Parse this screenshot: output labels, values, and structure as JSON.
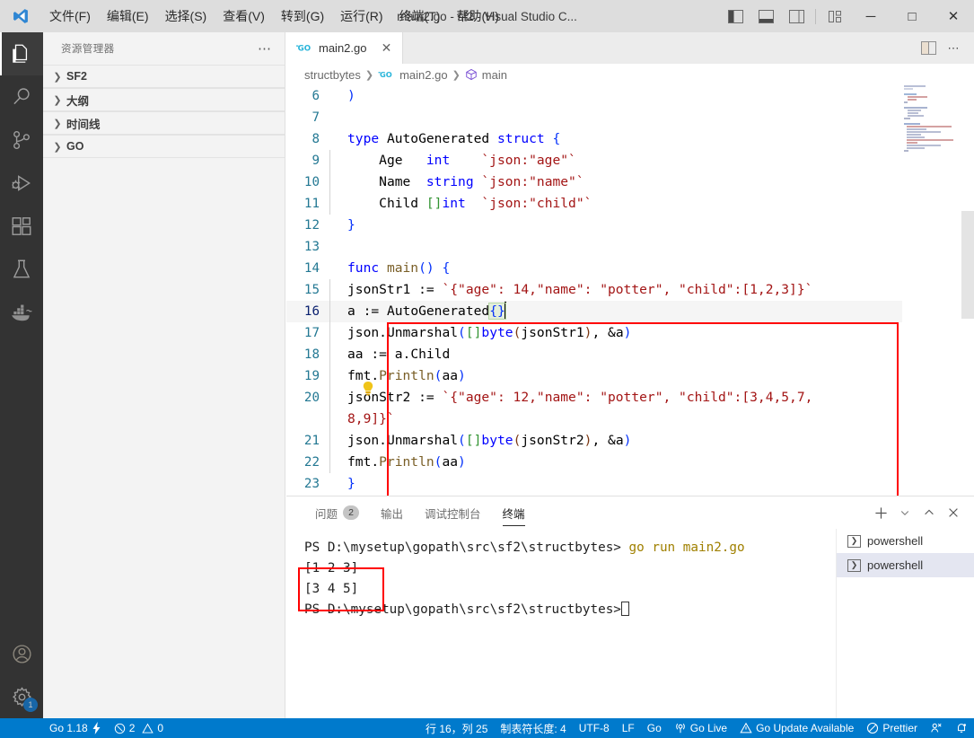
{
  "titlebar": {
    "menu": [
      {
        "label": "文件(F)",
        "accel": "F"
      },
      {
        "label": "编辑(E)",
        "accel": "E"
      },
      {
        "label": "选择(S)",
        "accel": "S"
      },
      {
        "label": "查看(V)",
        "accel": "V"
      },
      {
        "label": "转到(G)",
        "accel": "G"
      },
      {
        "label": "运行(R)",
        "accel": "R"
      },
      {
        "label": "终端(T)",
        "accel": "T"
      },
      {
        "label": "帮助(H)",
        "accel": "H"
      }
    ],
    "title": "main2.go - sf2 - Visual Studio C...",
    "layout_buttons": [
      "toggle-primary-sidebar",
      "toggle-panel",
      "toggle-secondary-sidebar",
      "customize-layout"
    ],
    "window_buttons": {
      "minimize": "─",
      "maximize": "□",
      "close": "✕"
    }
  },
  "activitybar": {
    "items": [
      {
        "name": "explorer",
        "icon": "files-icon",
        "active": true
      },
      {
        "name": "search",
        "icon": "search-icon",
        "active": false
      },
      {
        "name": "source-control",
        "icon": "source-control-icon",
        "active": false
      },
      {
        "name": "run-and-debug",
        "icon": "debug-icon",
        "active": false
      },
      {
        "name": "extensions",
        "icon": "extensions-icon",
        "active": false
      },
      {
        "name": "testing",
        "icon": "beaker-icon",
        "active": false
      },
      {
        "name": "docker",
        "icon": "docker-icon",
        "active": false
      }
    ],
    "bottom": [
      {
        "name": "accounts",
        "icon": "account-icon"
      },
      {
        "name": "manage",
        "icon": "gear-icon",
        "badge": "1"
      }
    ]
  },
  "sidebar": {
    "header": "资源管理器",
    "more_actions": "⋯",
    "sections": [
      {
        "label": "SF2",
        "expanded": false
      },
      {
        "label": "大纲",
        "expanded": false
      },
      {
        "label": "时间线",
        "expanded": false
      },
      {
        "label": "GO",
        "expanded": false
      }
    ]
  },
  "editor": {
    "tabs": [
      {
        "label": "main2.go",
        "icon": "go-file-icon",
        "active": true,
        "close": "✕"
      }
    ],
    "tab_actions": [
      "split-editor-icon",
      "more-actions-icon"
    ],
    "breadcrumb": [
      "structbytes",
      "main2.go",
      "main"
    ],
    "lines": [
      {
        "num": "6",
        "html": "<span class=\"pct\">)</span>"
      },
      {
        "num": "7",
        "html": ""
      },
      {
        "num": "8",
        "html": "<span class=\"k\">type</span> <span class=\"pl\">AutoGenerated</span> <span class=\"k\">struct</span> <span class=\"pct\">{</span>"
      },
      {
        "num": "9",
        "html": "    <span class=\"pl\">Age</span>   <span class=\"k\">int</span>    <span class=\"str\">`json:\"age\"`</span>"
      },
      {
        "num": "10",
        "html": "    <span class=\"pl\">Name</span>  <span class=\"k\">string</span> <span class=\"str\">`json:\"name\"`</span>"
      },
      {
        "num": "11",
        "html": "    <span class=\"pl\">Child</span> <span class=\"pcg\">[]</span><span class=\"k\">int</span>  <span class=\"str\">`json:\"child\"`</span>"
      },
      {
        "num": "12",
        "html": "<span class=\"pct\">}</span>"
      },
      {
        "num": "13",
        "html": ""
      },
      {
        "num": "14",
        "html": "<span class=\"k\">func</span> <span class=\"fn\">main</span><span class=\"pct\">()</span> <span class=\"pct\">{</span>"
      },
      {
        "num": "15",
        "html": "<span class=\"pl\">jsonStr1</span> <span class=\"pl\">:=</span> <span class=\"str\">`{\"age\": 14,\"name\": \"potter\", \"child\":[1,2,3]}`</span>"
      },
      {
        "num": "16",
        "html": "<span class=\"pl\">a</span> <span class=\"pl\">:=</span> <span class=\"pl\">AutoGenerated</span><span class=\"pct brace-match\">{}</span><span class=\"cursor\"></span>"
      },
      {
        "num": "17",
        "html": "<span class=\"pl\">json</span>.<span class=\"pl\">Unmarshal</span><span class=\"pct\">(</span><span class=\"pcg\">[]</span><span class=\"k\">byte</span><span class=\"pcp\">(</span><span class=\"pl\">jsonStr1</span><span class=\"pcp\">)</span>, &amp;<span class=\"pl\">a</span><span class=\"pct\">)</span>"
      },
      {
        "num": "18",
        "html": "<span class=\"pl\">aa</span> <span class=\"pl\">:=</span> <span class=\"pl\">a</span>.<span class=\"pl\">Child</span>"
      },
      {
        "num": "19",
        "html": "<span class=\"pl\">fmt</span>.<span class=\"fn\">Println</span><span class=\"pct\">(</span><span class=\"pl\">aa</span><span class=\"pct\">)</span>"
      },
      {
        "num": "20",
        "html": "<span class=\"pl\">jsonStr2</span> <span class=\"pl\">:=</span> <span class=\"str\">`{\"age\": 12,\"name\": \"potter\", \"child\":[3,4,5,7,\n8,9]}`</span>"
      },
      {
        "num": "21",
        "html": "<span class=\"pl\">json</span>.<span class=\"pl\">Unmarshal</span><span class=\"pct\">(</span><span class=\"pcg\">[]</span><span class=\"k\">byte</span><span class=\"pcp\">(</span><span class=\"pl\">jsonStr2</span><span class=\"pcp\">)</span>, &amp;<span class=\"pl\">a</span><span class=\"pct\">)</span>"
      },
      {
        "num": "22",
        "html": "<span class=\"pl\">fmt</span>.<span class=\"fn\">Println</span><span class=\"pct\">(</span><span class=\"pl\">aa</span><span class=\"pct\">)</span>"
      },
      {
        "num": "23",
        "html": "<span class=\"pct\">}</span>"
      },
      {
        "num": "24",
        "html": ""
      }
    ],
    "lightbulb_line": "16",
    "highlight_box_color": "#ff0000"
  },
  "panel": {
    "tabs": [
      {
        "label": "问题",
        "badge": "2",
        "active": false
      },
      {
        "label": "输出",
        "badge": "",
        "active": false
      },
      {
        "label": "调试控制台",
        "badge": "",
        "active": false
      },
      {
        "label": "终端",
        "badge": "",
        "active": true
      }
    ],
    "actions": [
      "add-terminal-icon",
      "chevron-down-icon",
      "maximize-panel-icon",
      "close-panel-icon"
    ],
    "terminal_lines": [
      {
        "prompt": "PS D:\\mysetup\\gopath\\src\\sf2\\structbytes>",
        "cmd": " go run main2.go",
        "type": "command"
      },
      {
        "prompt": "[1 2 3]",
        "cmd": "",
        "type": "output"
      },
      {
        "prompt": "[3 4 5]",
        "cmd": "",
        "type": "output"
      },
      {
        "prompt": "PS D:\\mysetup\\gopath\\src\\sf2\\structbytes>",
        "cmd": "",
        "type": "prompt"
      }
    ],
    "terminal_list": [
      {
        "label": "powershell",
        "selected": false
      },
      {
        "label": "powershell",
        "selected": true
      }
    ]
  },
  "statusbar": {
    "left": [
      {
        "name": "go-version",
        "label": "Go 1.18",
        "icon": "lightning-icon"
      },
      {
        "name": "problems",
        "label": "",
        "errors": "2",
        "warnings": "0"
      }
    ],
    "right": [
      {
        "name": "cursor-position",
        "label": "行 16，列 25"
      },
      {
        "name": "indentation",
        "label": "制表符长度: 4"
      },
      {
        "name": "encoding",
        "label": "UTF-8"
      },
      {
        "name": "eol",
        "label": "LF"
      },
      {
        "name": "language-mode",
        "label": "Go"
      },
      {
        "name": "go-live",
        "label": "Go Live",
        "icon": "broadcast-icon"
      },
      {
        "name": "go-update",
        "label": "Go Update Available",
        "icon": "warning-icon"
      },
      {
        "name": "prettier",
        "label": "Prettier",
        "icon": "prohibited-icon"
      },
      {
        "name": "remote-feedback",
        "label": "",
        "icon": "feedback-icon"
      },
      {
        "name": "notifications",
        "label": "",
        "icon": "bell-dot-icon"
      }
    ],
    "background": "#007acc"
  }
}
